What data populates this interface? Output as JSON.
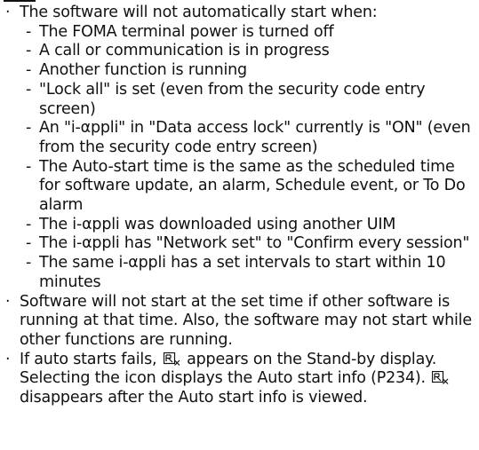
{
  "notes": {
    "not_start_intro": "The software will not automatically start when:",
    "conditions": [
      "The FOMA terminal power is turned off",
      "A call or communication is in progress",
      "Another function is running",
      "\"Lock all\" is set (even from the security code entry screen)",
      "An \"i-αppli\" in \"Data access lock\" currently is \"ON\" (even from the security code entry screen)",
      "The Auto-start time is the same as the scheduled time for software update, an alarm, Schedule event, or To Do alarm",
      "The i-αppli was downloaded using another UIM",
      "The i-αppli has \"Network set\" to \"Confirm every session\"",
      "The same i-αppli has a set intervals to start within 10 minutes"
    ],
    "busy_note": "Software will not start at the set time if other software is running at that time. Also, the software may not start while other functions are running.",
    "fail_note": {
      "part1": "If auto starts fails,",
      "part2": "appears on the Stand-by display. Selecting the icon displays the Auto start info (P234).",
      "part3": "disappears after the Auto start info is viewed."
    },
    "icon": "auto-start-failed-icon"
  }
}
